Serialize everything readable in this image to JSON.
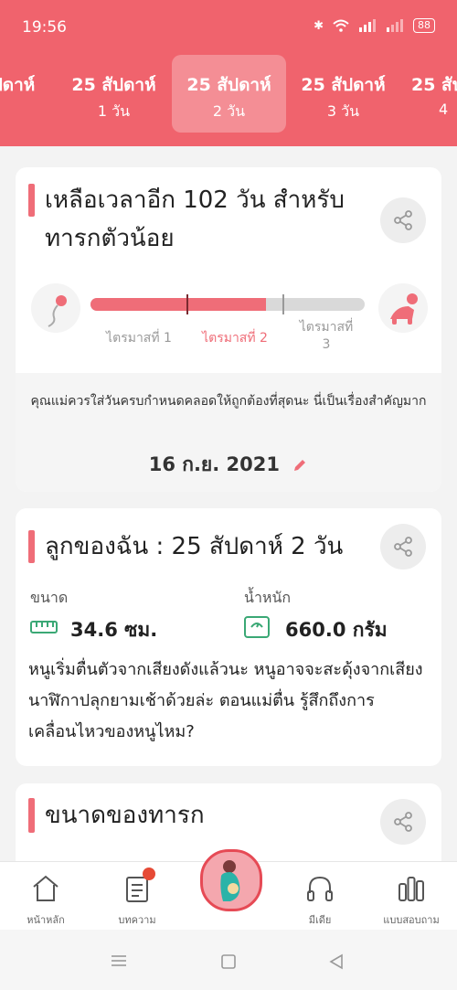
{
  "status": {
    "time": "19:56",
    "battery": "88"
  },
  "weeks": [
    {
      "l1": "ปดาห์",
      "l2": "",
      "selected": false
    },
    {
      "l1": "25 สัปดาห์",
      "l2": "1 วัน",
      "selected": false
    },
    {
      "l1": "25 สัปดาห์",
      "l2": "2 วัน",
      "selected": true
    },
    {
      "l1": "25 สัปดาห์",
      "l2": "3 วัน",
      "selected": false
    },
    {
      "l1": "25 สัป",
      "l2": "4",
      "selected": false
    }
  ],
  "countdown": {
    "title_line1": "เหลือเวลาอีก 102 วัน สำหรับ",
    "title_line2": "ทารกตัวน้อย",
    "progress_fraction": 0.64,
    "trimesters": [
      "ไตรมาสที่ 1",
      "ไตรมาสที่ 2",
      "ไตรมาสที่",
      "3"
    ],
    "due_text": "คุณแม่ควรใส่วันครบกำหนดคลอดให้ถูกต้องที่สุดนะ นี่เป็นเรื่องสำคัญมาก",
    "due_date": "16 ก.ย. 2021"
  },
  "baby": {
    "title": "ลูกของฉัน : 25 สัปดาห์ 2  วัน",
    "size_label": "ขนาด",
    "size_value": "34.6 ซม.",
    "weight_label": "น้ำหนัก",
    "weight_value": "660.0 กรัม",
    "description": "หนูเริ่มตื่นตัวจากเสียงดังแล้วนะ หนูอาจจะสะดุ้งจากเสียงนาฬิกาปลุกยามเช้าด้วยล่ะ ตอนแม่ตื่น รู้สึกถึงการเคลื่อนไหวของหนูไหม?"
  },
  "size_card": {
    "title": "ขนาดของทารก"
  },
  "bottom_nav": [
    {
      "label": "หน้าหลัก",
      "icon": "home-icon"
    },
    {
      "label": "บทความ",
      "icon": "article-icon"
    },
    {
      "label": "",
      "icon": "pregnant-mother-icon"
    },
    {
      "label": "มีเดีย",
      "icon": "headphones-icon"
    },
    {
      "label": "แบบสอบถาม",
      "icon": "chart-icon"
    }
  ],
  "colors": {
    "brand": "#f0636d",
    "accent": "#ef6d78"
  }
}
